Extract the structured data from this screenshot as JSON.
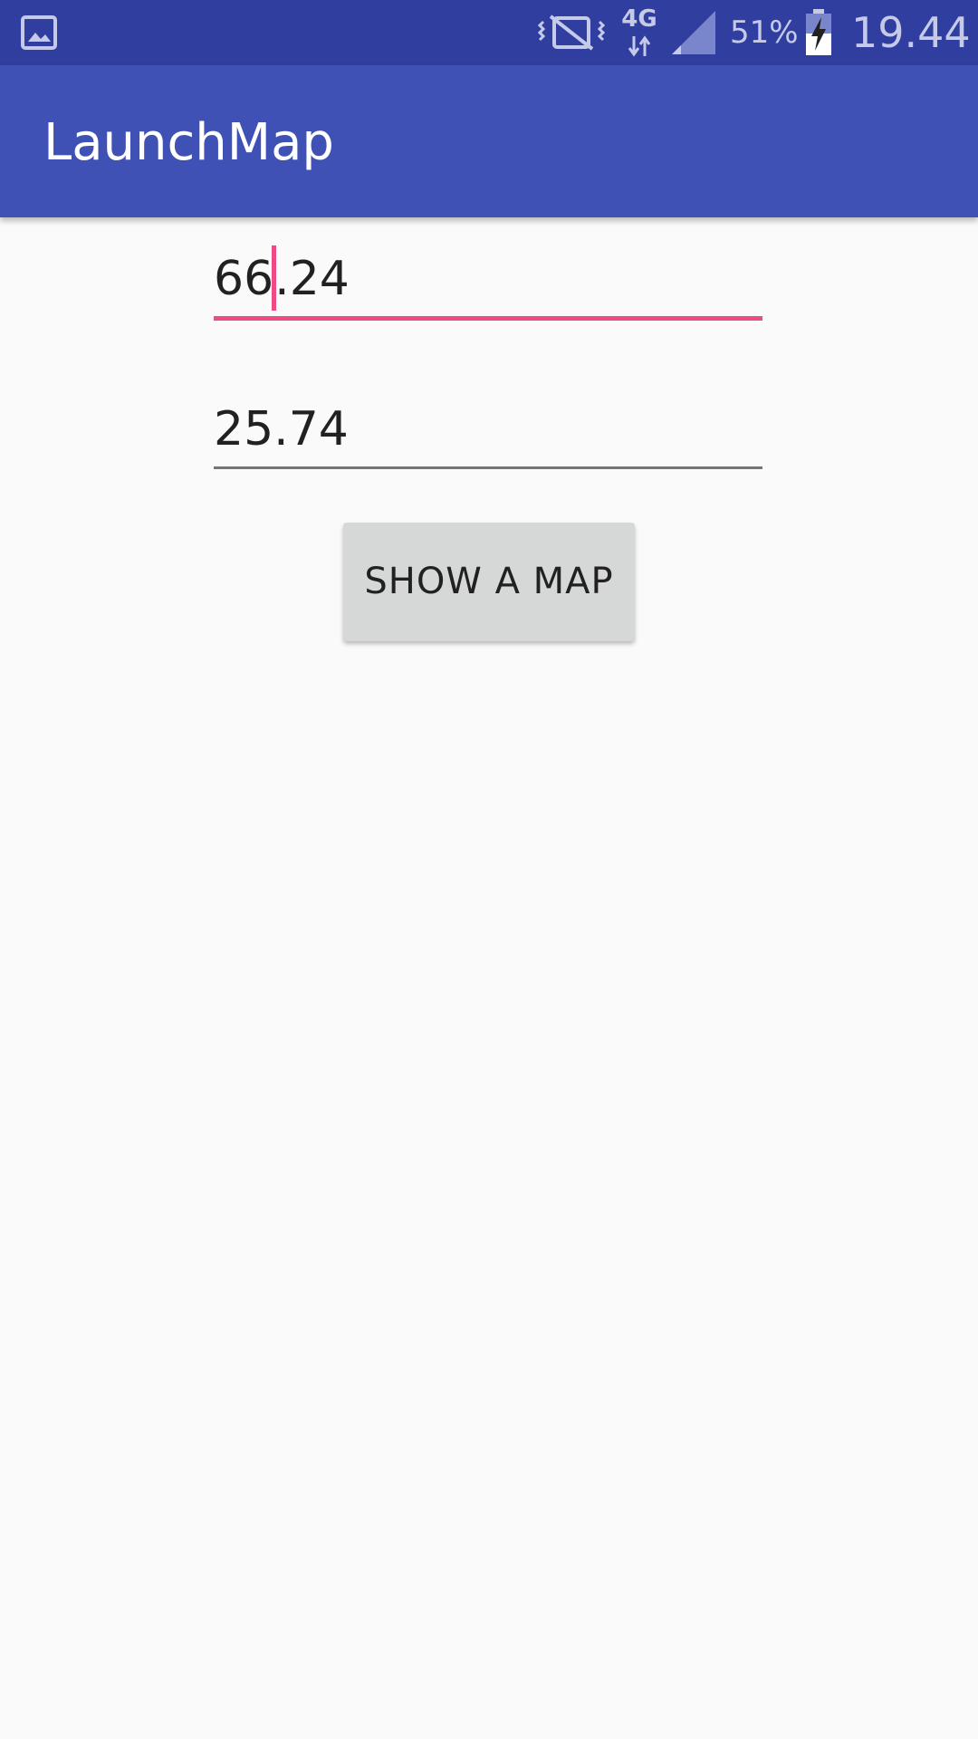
{
  "status_bar": {
    "network_type": "4G",
    "battery_percent": "51%",
    "time": "19.44",
    "icons": [
      "gallery-icon",
      "vibrate-icon",
      "data-arrows-icon",
      "signal-icon",
      "battery-charging-icon"
    ]
  },
  "app_bar": {
    "title": "LaunchMap"
  },
  "form": {
    "latitude_value_before_cursor": "66",
    "latitude_value_after_cursor": ".24",
    "longitude_value": "25.74",
    "show_map_label": "SHOW A MAP"
  },
  "colors": {
    "status_bar": "#303f9f",
    "app_bar": "#3f51b5",
    "accent": "#ee4b86",
    "background": "#fafafa",
    "button": "#d6d7d7"
  }
}
